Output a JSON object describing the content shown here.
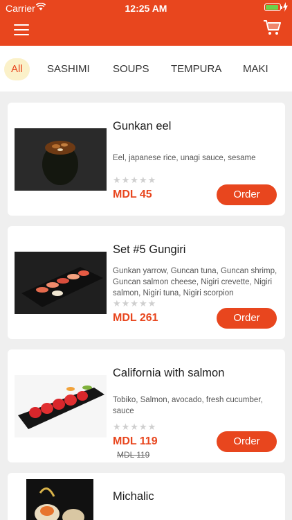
{
  "status_bar": {
    "carrier": "Carrier",
    "time": "12:25 AM"
  },
  "colors": {
    "accent": "#e8461e",
    "active_tab_bg": "#fbf1c9",
    "background": "#efefef",
    "battery": "#6cd14a"
  },
  "tabs": [
    {
      "label": "All",
      "active": true
    },
    {
      "label": "SASHIMI",
      "active": false
    },
    {
      "label": "SOUPS",
      "active": false
    },
    {
      "label": "TEMPURA",
      "active": false
    },
    {
      "label": "MAKI",
      "active": false
    }
  ],
  "products": [
    {
      "name": "Gunkan eel",
      "description": "Eel, japanese rice, unagi sauce, sesame",
      "stars": "★★★★★",
      "price": "MDL 45",
      "order_label": "Order"
    },
    {
      "name": "Set #5 Gungiri",
      "description": "Gunkan yarrow, Guncan tuna, Guncan shrimp, Guncan salmon cheese, Nigiri crevette, Nigiri salmon, Nigiri tuna, Nigiri scorpion",
      "stars": "★★★★★",
      "price": "MDL 261",
      "order_label": "Order"
    },
    {
      "name": "California with salmon",
      "description": "Tobiko, Salmon, avocado, fresh cucumber, sauce",
      "stars": "★★★★★",
      "price": "MDL 119",
      "old_price": "MDL 119",
      "order_label": "Order"
    },
    {
      "name": "Michalic"
    }
  ]
}
